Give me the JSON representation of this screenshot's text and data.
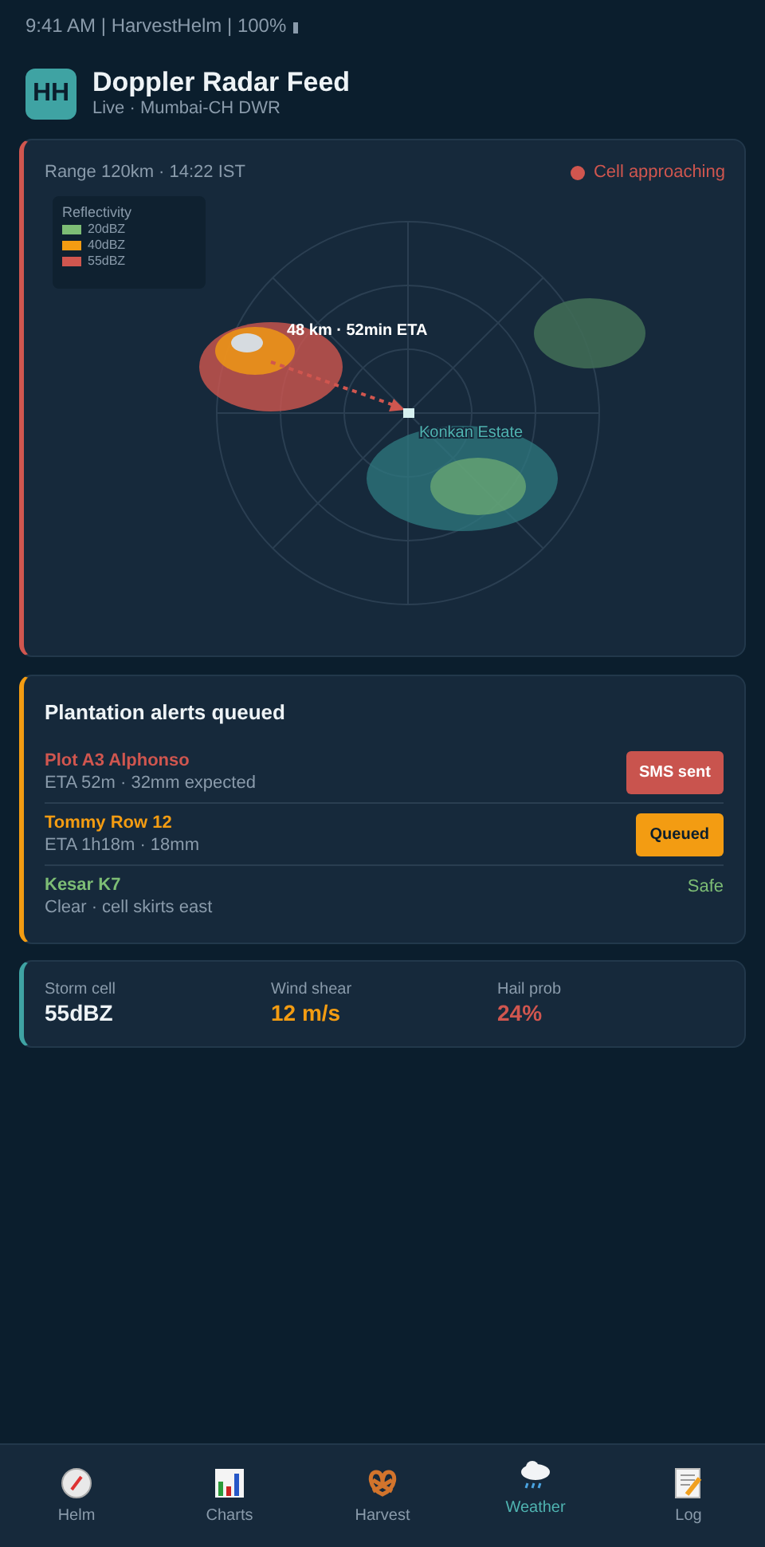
{
  "status_bar": {
    "text": "9:41 AM | HarvestHelm | 100%"
  },
  "header": {
    "logo": "HH",
    "title": "Doppler Radar Feed",
    "subtitle": "Live · Mumbai-CH DWR"
  },
  "radar": {
    "range": "Range 120km · 14:22 IST",
    "alert": "Cell approaching",
    "legend_title": "Reflectivity",
    "legend": [
      {
        "label": "20dBZ",
        "color": "#7dbd75"
      },
      {
        "label": "40dBZ",
        "color": "#f39c12"
      },
      {
        "label": "55dBZ",
        "color": "#d0564f"
      }
    ],
    "track_label": "48 km · 52min ETA",
    "site_label": "Konkan Estate"
  },
  "alerts": {
    "title": "Plantation alerts queued",
    "items": [
      {
        "name": "Plot A3 Alphonso",
        "detail": "ETA 52m · 32mm expected",
        "status": "SMS sent",
        "kind": "sent"
      },
      {
        "name": "Tommy Row 12",
        "detail": "ETA 1h18m · 18mm",
        "status": "Queued",
        "kind": "queued"
      },
      {
        "name": "Kesar K7",
        "detail": "Clear · cell skirts east",
        "status": "Safe",
        "kind": "safe"
      }
    ]
  },
  "stats": [
    {
      "label": "Storm cell",
      "value": "55dBZ",
      "kind": "neutral"
    },
    {
      "label": "Wind shear",
      "value": "12 m/s",
      "kind": "warning"
    },
    {
      "label": "Hail prob",
      "value": "24%",
      "kind": "danger"
    }
  ],
  "tabs": [
    {
      "label": "Helm",
      "kind": "compass",
      "selected": false
    },
    {
      "label": "Charts",
      "kind": "chart",
      "selected": false
    },
    {
      "label": "Harvest",
      "kind": "pretzel",
      "selected": false
    },
    {
      "label": "Weather",
      "kind": "cloud",
      "selected": true
    },
    {
      "label": "Log",
      "kind": "note",
      "selected": false
    }
  ]
}
